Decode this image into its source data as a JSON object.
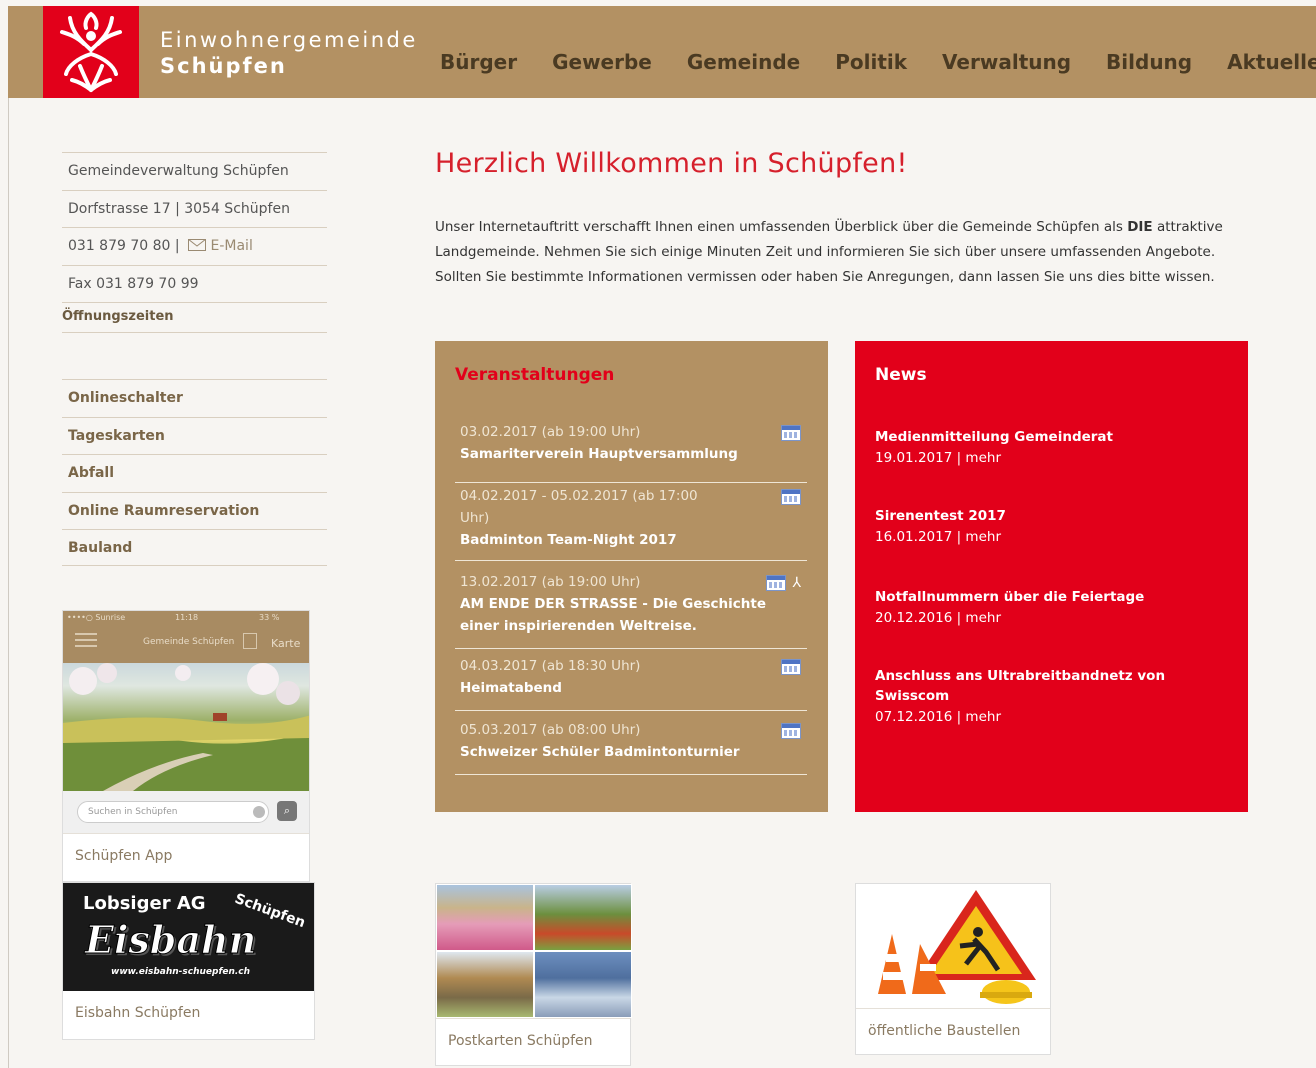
{
  "header": {
    "brand_line1": "Einwohnergemeinde",
    "brand_line2": "Schüpfen",
    "nav": [
      "Bürger",
      "Gewerbe",
      "Gemeinde",
      "Politik",
      "Verwaltung",
      "Bildung",
      "Aktuelles"
    ]
  },
  "sidebar": {
    "contact": {
      "name": "Gemeindeverwaltung Schüpfen",
      "address": "Dorfstrasse 17 | 3054 Schüpfen",
      "phone": "031 879 70 80 |",
      "email_label": "E-Mail",
      "fax": "Fax 031 879 70 99",
      "hours": "Öffnungszeiten"
    },
    "links": [
      "Onlineschalter",
      "Tageskarten",
      "Abfall",
      "Online Raumreservation",
      "Bauland"
    ],
    "app_card": {
      "carrier": "••••○ Sunrise",
      "time": "11:18",
      "battery": "33 %",
      "screen_title": "Gemeinde Schüpfen",
      "map_label": "Karte",
      "search_placeholder": "Suchen in Schüpfen",
      "caption": "Schüpfen App"
    },
    "eis_card": {
      "company": "Lobsiger AG",
      "tag": "Schüpfen",
      "script": "Eisbahn",
      "url": "www.eisbahn-schuepfen.ch",
      "caption": "Eisbahn Schüpfen"
    }
  },
  "main": {
    "title": "Herzlich Willkommen in Schüpfen!",
    "intro_1": "Unser Internetauftritt verschafft Ihnen einen umfassenden Überblick über die Gemeinde Schüpfen als",
    "intro_bold": "DIE",
    "intro_2": "attraktive Landgemeinde. Nehmen Sie sich einige Minuten Zeit und informieren Sie sich über unsere umfassenden Angebote. Sollten Sie bestimmte Informationen vermissen oder haben Sie Anregungen, dann lassen Sie uns dies bitte wissen."
  },
  "events": {
    "title": "Veranstaltungen",
    "items": [
      {
        "date": "03.02.2017 (ab 19:00 Uhr)",
        "name": "Samariterverein Hauptversammlung"
      },
      {
        "date": "04.02.2017 - 05.02.2017 (ab 17:00 Uhr)",
        "name": "Badminton Team-Night 2017"
      },
      {
        "date": "13.02.2017 (ab 19:00 Uhr)",
        "name": "AM ENDE DER STRASSE - Die Geschichte einer inspirierenden Weltreise."
      },
      {
        "date": "04.03.2017 (ab 18:30 Uhr)",
        "name": "Heimatabend"
      },
      {
        "date": "05.03.2017 (ab 08:00 Uhr)",
        "name": "Schweizer Schüler Badmintonturnier"
      }
    ]
  },
  "news": {
    "title": "News",
    "items": [
      {
        "title": "Medienmitteilung Gemeinderat",
        "date": "19.01.2017 | mehr"
      },
      {
        "title": "Sirenentest 2017",
        "date": "16.01.2017 | mehr"
      },
      {
        "title": "Notfallnummern über die Feiertage",
        "date": "20.12.2016 | mehr"
      },
      {
        "title": "Anschluss ans Ultrabreitbandnetz von Swisscom",
        "date": "07.12.2016 | mehr"
      }
    ]
  },
  "bottom": {
    "postcards_caption": "Postkarten Schüpfen",
    "construction_caption": "öffentliche Baustellen"
  },
  "colors": {
    "brand_brown": "#b39163",
    "brand_red": "#e2001a",
    "title_red": "#d6202c"
  }
}
